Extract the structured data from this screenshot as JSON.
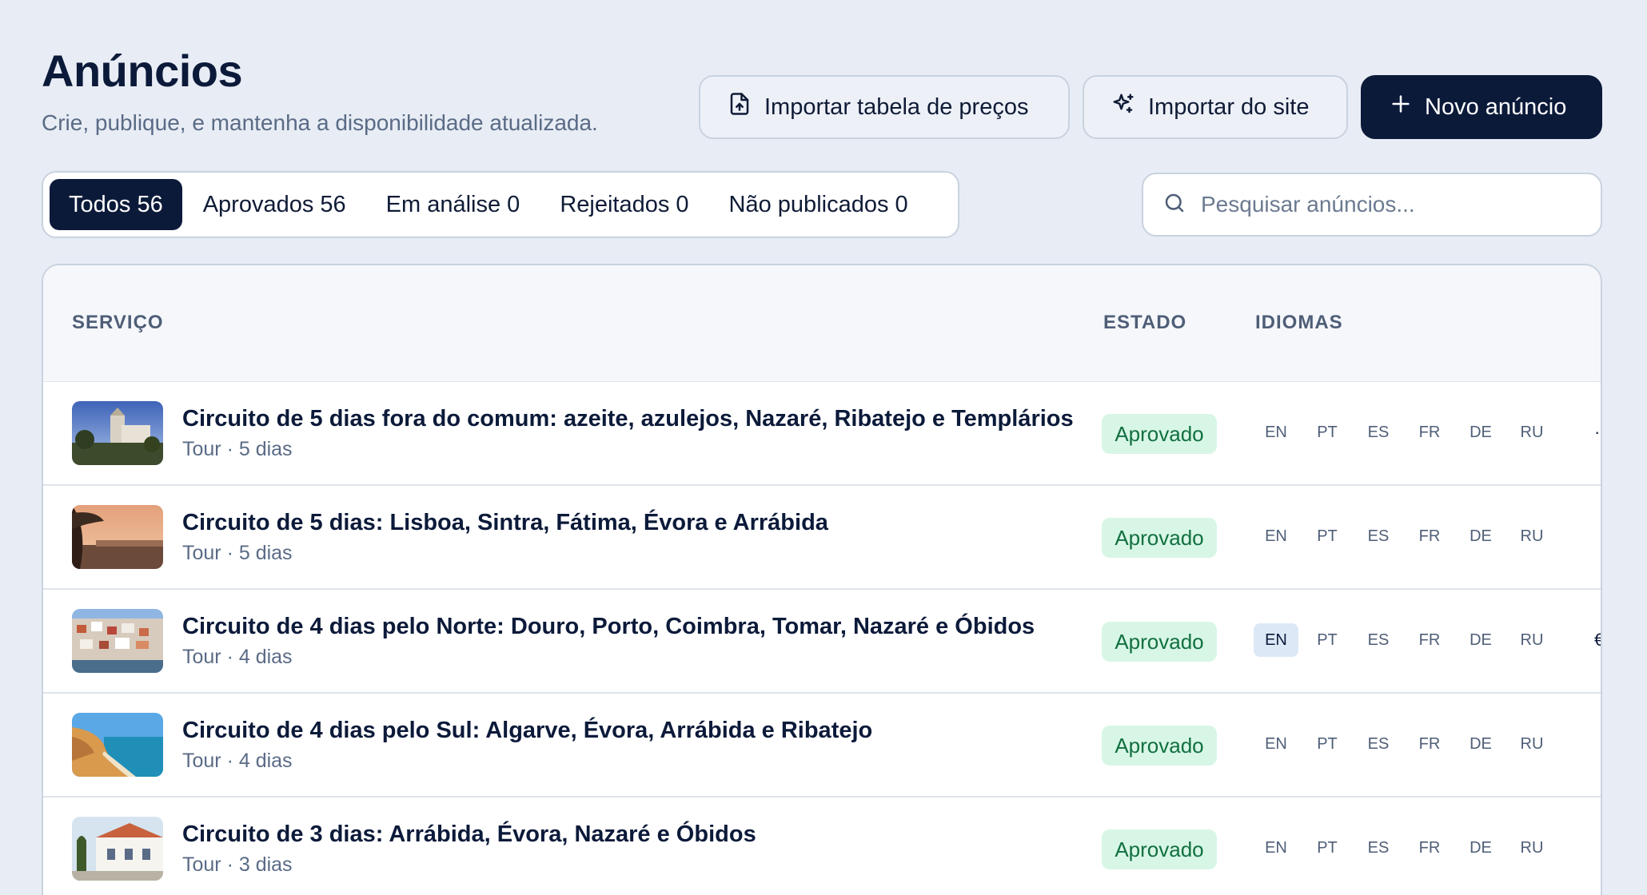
{
  "header": {
    "title": "Anúncios",
    "subtitle": "Crie, publique, e mantenha a disponibilidade atualizada."
  },
  "actions": {
    "import_prices": "Importar tabela de preços",
    "import_site": "Importar do site",
    "new_listing": "Novo anúncio"
  },
  "tabs": [
    {
      "label": "Todos 56",
      "active": true
    },
    {
      "label": "Aprovados 56",
      "active": false
    },
    {
      "label": "Em análise 0",
      "active": false
    },
    {
      "label": "Rejeitados 0",
      "active": false
    },
    {
      "label": "Não publicados 0",
      "active": false
    }
  ],
  "search": {
    "placeholder": "Pesquisar anúncios..."
  },
  "table": {
    "columns": {
      "service": "SERVIÇO",
      "status": "ESTADO",
      "languages": "IDIOMAS"
    },
    "languages": [
      "EN",
      "PT",
      "ES",
      "FR",
      "DE",
      "RU"
    ],
    "rows": [
      {
        "title": "Circuito de 5 dias fora do comum: azeite, azulejos, Nazaré, Ribatejo e Templários",
        "subtitle": "Tour · 5 dias",
        "status": "Aprovado",
        "highlight_lang": ""
      },
      {
        "title": "Circuito de 5 dias: Lisboa, Sintra, Fátima, Évora e Arrábida",
        "subtitle": "Tour · 5 dias",
        "status": "Aprovado",
        "highlight_lang": ""
      },
      {
        "title": "Circuito de 4 dias pelo Norte: Douro, Porto, Coimbra, Tomar, Nazaré e Óbidos",
        "subtitle": "Tour · 4 dias",
        "status": "Aprovado",
        "highlight_lang": "EN"
      },
      {
        "title": "Circuito de 4 dias pelo Sul: Algarve, Évora, Arrábida e Ribatejo",
        "subtitle": "Tour · 4 dias",
        "status": "Aprovado",
        "highlight_lang": ""
      },
      {
        "title": "Circuito de 3 dias: Arrábida, Évora, Nazaré e Óbidos",
        "subtitle": "Tour · 3 dias",
        "status": "Aprovado",
        "highlight_lang": ""
      }
    ]
  },
  "colors": {
    "primary": "#0c1a3a",
    "background": "#e8edf5",
    "approved_bg": "#d8f6e6",
    "approved_text": "#117040"
  },
  "icons": {
    "import_prices": "file-upload-icon",
    "import_site": "sparkles-icon",
    "new_listing": "plus-icon",
    "search": "search-icon"
  }
}
